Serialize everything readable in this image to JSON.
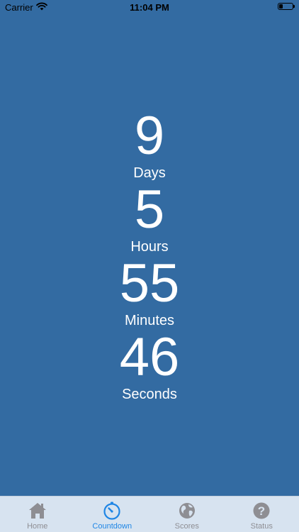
{
  "status_bar": {
    "carrier": "Carrier",
    "time": "11:04 PM",
    "battery_level": 0.3
  },
  "countdown": [
    {
      "value": "9",
      "label": "Days"
    },
    {
      "value": "5",
      "label": "Hours"
    },
    {
      "value": "55",
      "label": "Minutes"
    },
    {
      "value": "46",
      "label": "Seconds"
    }
  ],
  "tabs": [
    {
      "label": "Home",
      "icon": "home-icon",
      "active": false
    },
    {
      "label": "Countdown",
      "icon": "timer-icon",
      "active": true
    },
    {
      "label": "Scores",
      "icon": "globe-icon",
      "active": false
    },
    {
      "label": "Status",
      "icon": "question-icon",
      "active": false
    }
  ],
  "colors": {
    "background": "#336ba2",
    "tab_bar": "#d7e3f0",
    "tab_active": "#1f86e5",
    "tab_inactive": "#8e8e93"
  }
}
